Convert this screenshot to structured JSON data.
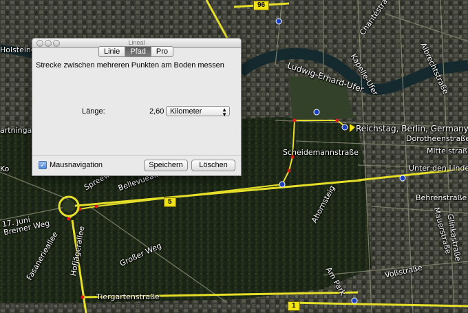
{
  "map": {
    "labels": {
      "reichstag": "Reichstag, Berlin, Germany",
      "scheidemann": "Scheidemannstraße",
      "dorotheen": "Dorotheenstraße",
      "mittel": "Mittelstraße",
      "unter_den_linden": "Unter den Linden",
      "behren": "Behrenstraße",
      "ahornsteig": "Ahornsteig",
      "grosser_weg": "Großer Weg",
      "tiergarten": "Tiergartenstraße",
      "vossstrasse": "Voßstraße",
      "am_park": "Am Park",
      "hofjaeger": "Hofjägerallee",
      "fasanerie": "Fasanerieallee",
      "siebzehnter_juni": "17. Juni",
      "bremer_weg": "Bremer Weg",
      "holsteiner": "Holsteine",
      "spreeweg": "Spreeweg",
      "bellevue": "Bellevueallee",
      "ludwig_erhard": "Ludwig-Erhard-Ufer",
      "kapelle": "Kapelle-Ufer",
      "charite": "Charitéstraße",
      "albrecht": "Albrechtstraße",
      "mauerstrasse": "Mauerstraße",
      "glinka": "Glinkastraße",
      "gartningal": "artningal",
      "ko": "Ko"
    },
    "shields": [
      "96",
      "5",
      "1"
    ]
  },
  "dialog": {
    "window_title": "Lineal",
    "tabs": [
      "Linie",
      "Pfad",
      "Pro"
    ],
    "active_tab": "Pfad",
    "description": "Strecke zwischen mehreren Punkten am Boden messen",
    "length_label": "Länge:",
    "length_value": "2,60",
    "unit_selected": "Kilometer",
    "mouse_nav_label": "Mausnavigation",
    "mouse_nav_checked": true,
    "save_label": "Speichern",
    "delete_label": "Löschen"
  },
  "colors": {
    "road_yellow": "#e6df2a",
    "path_point": "#e21a1a",
    "tab_active": "#6a6a6a"
  }
}
